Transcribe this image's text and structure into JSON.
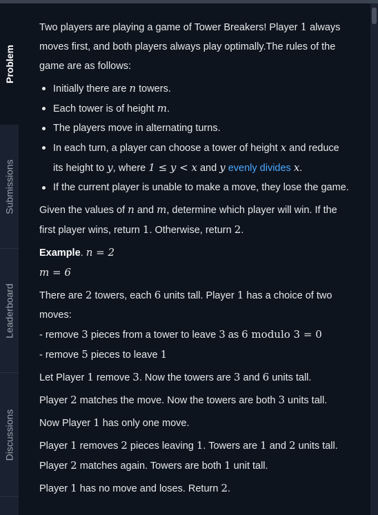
{
  "sidebar": {
    "tabs": [
      {
        "label": "Problem",
        "active": true
      },
      {
        "label": "Submissions",
        "active": false
      },
      {
        "label": "Leaderboard",
        "active": false
      },
      {
        "label": "Discussions",
        "active": false
      }
    ]
  },
  "problem": {
    "intro_a": "Two players are playing a game of Tower Breakers! Player ",
    "intro_num": "1",
    "intro_b": " always moves first, and both players always play optimally.The rules of the game are as follows:",
    "rules": {
      "r1_a": "Initially there are ",
      "r1_var": "n",
      "r1_b": " towers.",
      "r2_a": "Each tower is of height ",
      "r2_var": "m",
      "r2_b": ".",
      "r3": "The players move in alternating turns.",
      "r4_a": "In each turn, a player can choose a tower of height ",
      "r4_x": "x",
      "r4_b": " and reduce its height to ",
      "r4_y": "y",
      "r4_c": ", where ",
      "r4_ineq": "1 ≤ y < x",
      "r4_d": " and ",
      "r4_y2": "y",
      "r4_link": "evenly divides",
      "r4_x2": "x",
      "r4_e": ".",
      "r5": "If the current player is unable to make a move, they lose the game."
    },
    "given_a": "Given the values of ",
    "given_n": "n",
    "given_b": " and ",
    "given_m": "m",
    "given_c": ", determine which player will win. If the first player wins, return ",
    "given_r1": "1",
    "given_d": ". Otherwise, return ",
    "given_r2": "2",
    "given_e": ".",
    "example_label": "Example",
    "example_n": "n = 2",
    "example_m": "m = 6",
    "ex1_a": "There are ",
    "ex1_n": "2",
    "ex1_b": " towers, each ",
    "ex1_m": "6",
    "ex1_c": " units tall. Player ",
    "ex1_p": "1",
    "ex1_d": " has a choice of two moves:",
    "ex2_a": "- remove ",
    "ex2_n": "3",
    "ex2_b": " pieces from a tower to leave ",
    "ex2_n2": "3",
    "ex2_c": " as ",
    "ex2_expr": "6 modulo 3 = 0",
    "ex3_a": "- remove ",
    "ex3_n": "5",
    "ex3_b": " pieces to leave ",
    "ex3_n2": "1",
    "ex4_a": "Let Player ",
    "ex4_p": "1",
    "ex4_b": " remove ",
    "ex4_n": "3",
    "ex4_c": ". Now the towers are ",
    "ex4_n2": "3",
    "ex4_d": " and ",
    "ex4_n3": "6",
    "ex4_e": " units tall.",
    "ex5_a": "Player ",
    "ex5_p": "2",
    "ex5_b": " matches the move. Now the towers are both ",
    "ex5_n": "3",
    "ex5_c": " units tall.",
    "ex6_a": "Now Player ",
    "ex6_p": "1",
    "ex6_b": " has only one move.",
    "ex7_a": "Player ",
    "ex7_p": "1",
    "ex7_b": " removes ",
    "ex7_n": "2",
    "ex7_c": " pieces leaving ",
    "ex7_n2": "1",
    "ex7_d": ". Towers are ",
    "ex7_n3": "1",
    "ex7_e": " and ",
    "ex7_n4": "2",
    "ex7_f": " units tall.",
    "ex8_a": "Player ",
    "ex8_p": "2",
    "ex8_b": " matches again. Towers are both ",
    "ex8_n": "1",
    "ex8_c": " unit tall.",
    "ex9_a": "Player ",
    "ex9_p": "1",
    "ex9_b": " has no move and loses. Return ",
    "ex9_n": "2",
    "ex9_c": "."
  },
  "colors": {
    "background": "#0e141e",
    "sidebar": "#1a2130",
    "link": "#4aa8ff",
    "text": "#e6e8ea"
  }
}
